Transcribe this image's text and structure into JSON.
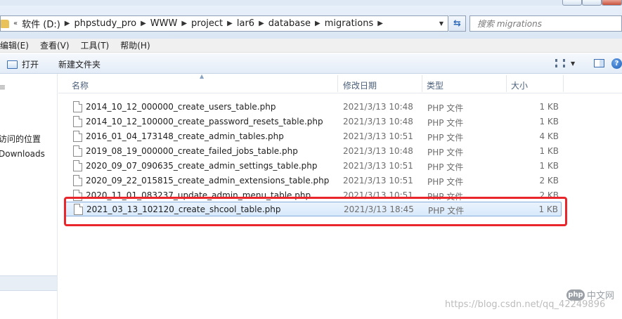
{
  "address": {
    "overflow": "«",
    "segments": [
      "软件 (D:)",
      "phpstudy_pro",
      "WWW",
      "project",
      "lar6",
      "database",
      "migrations"
    ]
  },
  "search": {
    "placeholder": "搜索 migrations"
  },
  "menu": [
    "编辑(E)",
    "查看(V)",
    "工具(T)",
    "帮助(H)"
  ],
  "toolbar": {
    "open_label": "打开",
    "new_folder_label": "新建文件夹"
  },
  "nav": {
    "items": [
      "访问的位置",
      "Downloads"
    ]
  },
  "columns": {
    "name": "名称",
    "date": "修改日期",
    "type": "类型",
    "size": "大小"
  },
  "files": [
    {
      "name": "2014_10_12_000000_create_users_table.php",
      "date": "2021/3/13 10:48",
      "type": "PHP 文件",
      "size": "1 KB"
    },
    {
      "name": "2014_10_12_100000_create_password_resets_table.php",
      "date": "2021/3/13 10:48",
      "type": "PHP 文件",
      "size": "1 KB"
    },
    {
      "name": "2016_01_04_173148_create_admin_tables.php",
      "date": "2021/3/13 10:51",
      "type": "PHP 文件",
      "size": "4 KB"
    },
    {
      "name": "2019_08_19_000000_create_failed_jobs_table.php",
      "date": "2021/3/13 10:48",
      "type": "PHP 文件",
      "size": "1 KB"
    },
    {
      "name": "2020_09_07_090635_create_admin_settings_table.php",
      "date": "2021/3/13 10:51",
      "type": "PHP 文件",
      "size": "1 KB"
    },
    {
      "name": "2020_09_22_015815_create_admin_extensions_table.php",
      "date": "2021/3/13 10:51",
      "type": "PHP 文件",
      "size": "2 KB"
    },
    {
      "name": "2020_11_01_083237_update_admin_menu_table.php",
      "date": "2021/3/13 10:51",
      "type": "PHP 文件",
      "size": "2 KB"
    },
    {
      "name": "2021_03_13_102120_create_shcool_table.php",
      "date": "2021/3/13 18:45",
      "type": "PHP 文件",
      "size": "1 KB"
    }
  ],
  "watermark": {
    "url": "https://blog.csdn.net/qq_42249896",
    "logo_badge": "php",
    "logo_text": "中文网"
  },
  "colors": {
    "highlight_border": "#e8262b",
    "selection_bg": "#d8e9fb"
  }
}
